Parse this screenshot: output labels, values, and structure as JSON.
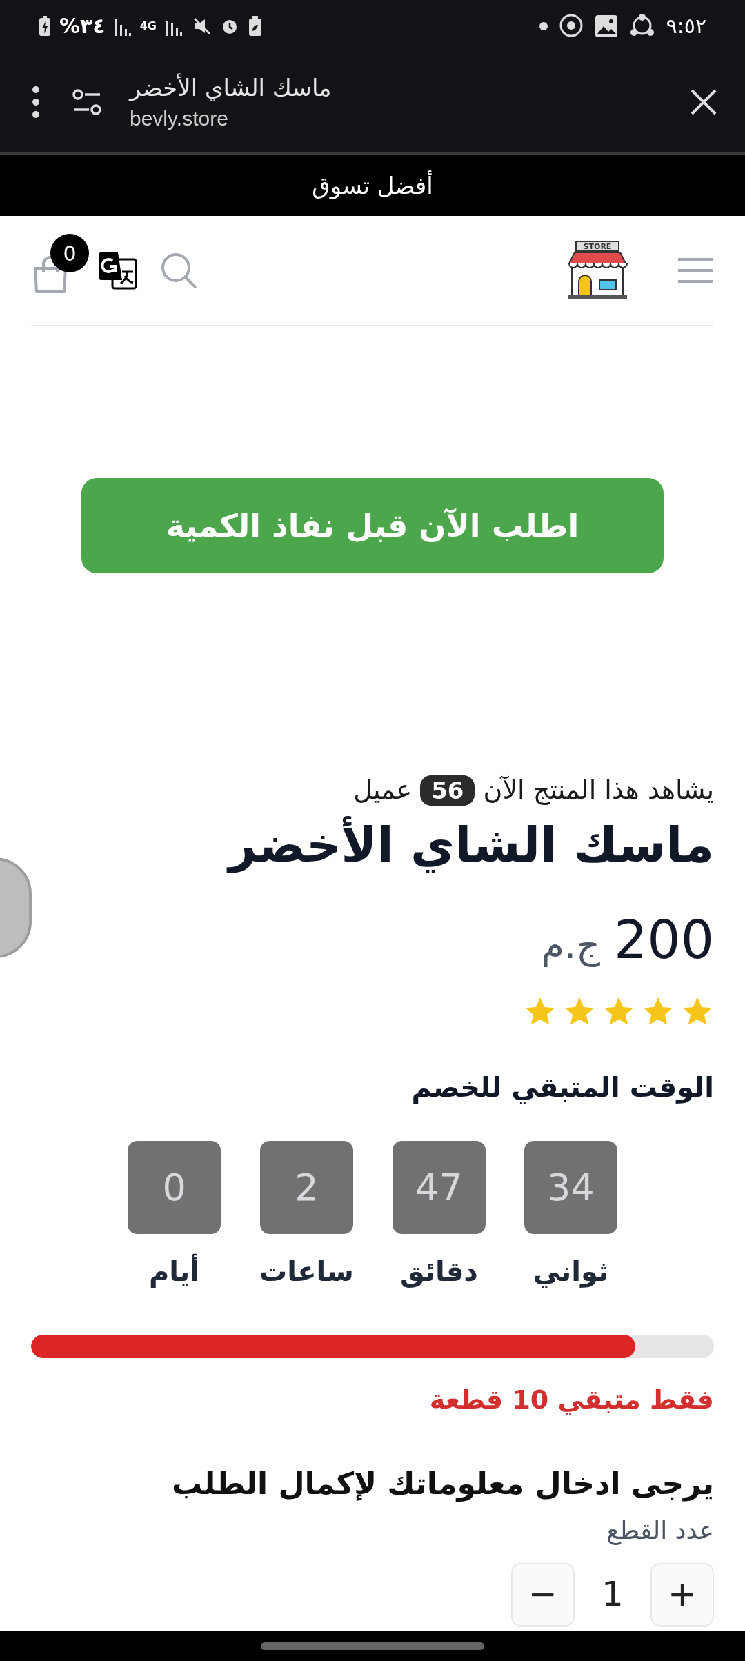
{
  "status_bar": {
    "time": "٩:٥٢",
    "battery": "%٣٤",
    "network": "4G"
  },
  "browser": {
    "title": "ماسك الشاي الأخضر",
    "url": "bevly.store"
  },
  "banner": "أفضل تسوق",
  "header": {
    "cart_count": "0",
    "logo_text": "STORE"
  },
  "order_button": "اطلب الآن قبل نفاذ الكمية",
  "product": {
    "viewers_before": "يشاهد هذا المنتج الآن",
    "viewers_count": "56",
    "viewers_after": "عميل",
    "title": "ماسك الشاي الأخضر",
    "price": "200",
    "currency": "ج.م",
    "stars": 5
  },
  "countdown": {
    "title": "الوقت المتبقي للخصم",
    "units": [
      {
        "value": "34",
        "label": "ثواني"
      },
      {
        "value": "47",
        "label": "دقائق"
      },
      {
        "value": "2",
        "label": "ساعات"
      },
      {
        "value": "0",
        "label": "أيام"
      }
    ]
  },
  "stock": {
    "level": 0.885,
    "text": "فقط متبقي 10 قطعة"
  },
  "form": {
    "title": "يرجى ادخال معلوماتك لإكمال الطلب",
    "quantity_label": "عدد القطع",
    "quantity": {
      "plus": "+",
      "value": "1",
      "minus": "−"
    }
  }
}
